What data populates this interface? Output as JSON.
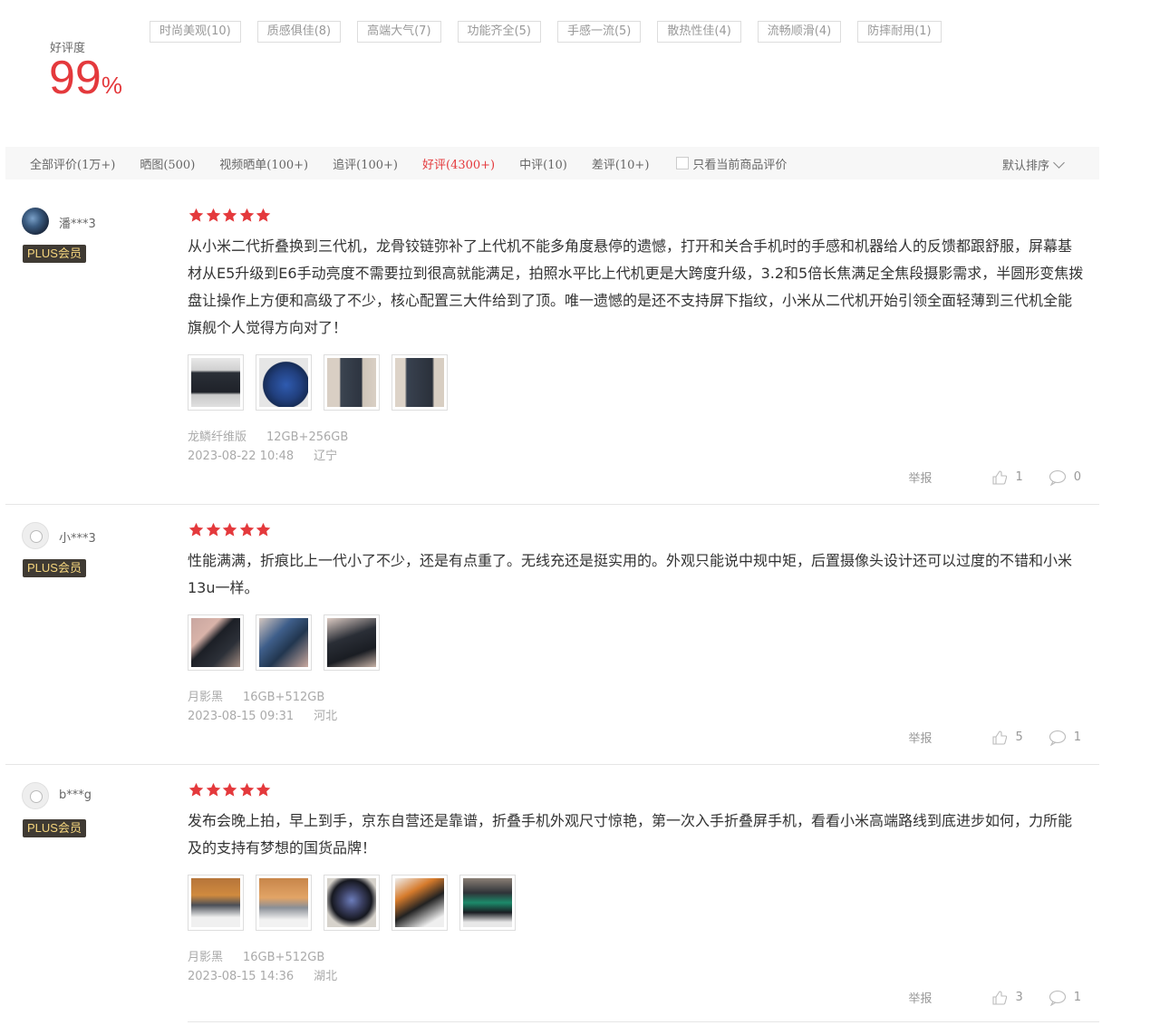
{
  "summary": {
    "rating_label": "好评度",
    "rating_number": "99",
    "rating_percent": "%",
    "tags": [
      "时尚美观(10)",
      "质感俱佳(8)",
      "高端大气(7)",
      "功能齐全(5)",
      "手感一流(5)",
      "散热性佳(4)",
      "流畅顺滑(4)",
      "防摔耐用(1)"
    ]
  },
  "filters": {
    "tabs": [
      "全部评价(1万+)",
      "晒图(500)",
      "视频晒单(100+)",
      "追评(100+)",
      "好评(4300+)",
      "中评(10)",
      "差评(10+)"
    ],
    "active_tab": "好评(4300+)",
    "only_current_label": "只看当前商品评价",
    "sort_label": "默认排序"
  },
  "colors": {
    "accent": "#e4393c",
    "star": "#e4393c",
    "badge_bg": "#3f3a33",
    "badge_text": "#f5d57d"
  },
  "reviews": [
    {
      "user": "潘***3",
      "badge": "PLUS会员",
      "stars": 5,
      "content": "从小米二代折叠换到三代机，龙骨铰链弥补了上代机不能多角度悬停的遗憾，打开和关合手机时的手感和机器给人的反馈都跟舒服，屏幕基材从E5升级到E6手动亮度不需要拉到很高就能满足，拍照水平比上代机更是大跨度升级，3.2和5倍长焦满足全焦段摄影需求，半圆形变焦拨盘让操作上方便和高级了不少，核心配置三大件给到了顶。唯一遗憾的是还不支持屏下指纹，小米从二代机开始引领全面轻薄到三代机全能旗舰个人觉得方向对了！",
      "color": "龙鳞纤维版",
      "spec": "12GB+256GB",
      "date": "2023-08-22 10:48",
      "region": "辽宁",
      "report": "举报",
      "likes": "1",
      "replies": "0"
    },
    {
      "user": "小***3",
      "badge": "PLUS会员",
      "stars": 5,
      "content": "性能满满，折痕比上一代小了不少，还是有点重了。无线充还是挺实用的。外观只能说中规中矩，后置摄像头设计还可以过度的不错和小米13u一样。",
      "color": "月影黑",
      "spec": "16GB+512GB",
      "date": "2023-08-15 09:31",
      "region": "河北",
      "report": "举报",
      "likes": "5",
      "replies": "1"
    },
    {
      "user": "b***g",
      "badge": "PLUS会员",
      "stars": 5,
      "content": "发布会晚上拍，早上到手，京东自营还是靠谱，折叠手机外观尺寸惊艳，第一次入手折叠屏手机，看看小米高端路线到底进步如何，力所能及的支持有梦想的国货品牌！",
      "color": "月影黑",
      "spec": "16GB+512GB",
      "date": "2023-08-15 14:36",
      "region": "湖北",
      "report": "举报",
      "likes": "3",
      "replies": "1"
    }
  ]
}
